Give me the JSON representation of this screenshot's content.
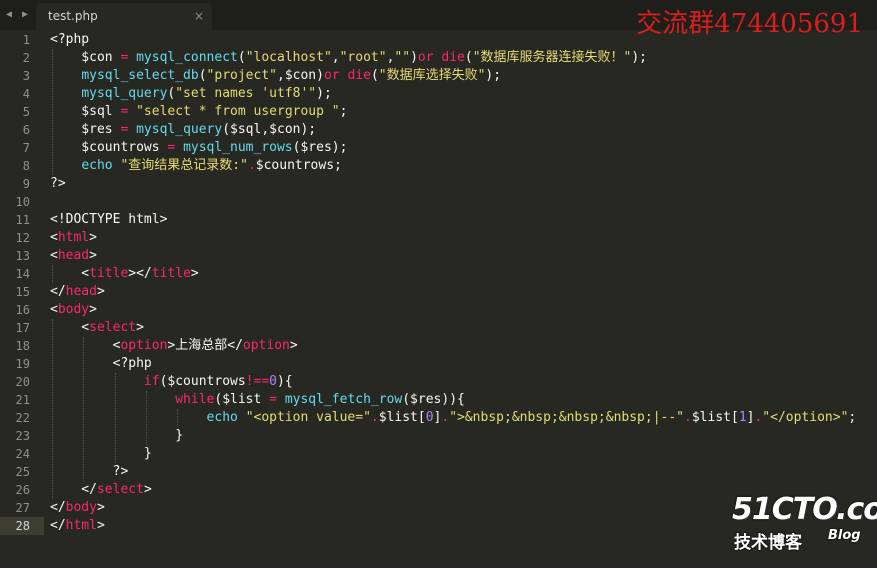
{
  "tabbar": {
    "nav_arrows": "◀ ▶",
    "tab_name": "test.php",
    "close_glyph": "×"
  },
  "watermark_text": "交流群474405691",
  "logo": {
    "main": "51CTO.com",
    "sub": "技术博客",
    "blog": "Blog"
  },
  "colors": {
    "background": "#272822",
    "keyword": "#f92672",
    "function": "#66d9ef",
    "string": "#e6db74",
    "number": "#ae81ff",
    "text": "#f8f8f2"
  },
  "active_line": 28,
  "line_numbers": [
    "1",
    "2",
    "3",
    "4",
    "5",
    "6",
    "7",
    "8",
    "9",
    "10",
    "11",
    "12",
    "13",
    "14",
    "15",
    "16",
    "17",
    "18",
    "19",
    "20",
    "21",
    "22",
    "23",
    "24",
    "25",
    "26",
    "27",
    "28"
  ],
  "code_lines": [
    [
      [
        "txt",
        "<?php"
      ]
    ],
    [
      [
        "txt",
        "    $con "
      ],
      [
        "kw",
        "="
      ],
      [
        "txt",
        " "
      ],
      [
        "fn",
        "mysql_connect"
      ],
      [
        "txt",
        "("
      ],
      [
        "str",
        "\"localhost\""
      ],
      [
        "txt",
        ","
      ],
      [
        "str",
        "\"root\""
      ],
      [
        "txt",
        ","
      ],
      [
        "str",
        "\"\""
      ],
      [
        "txt",
        ")"
      ],
      [
        "kw",
        "or"
      ],
      [
        "txt",
        " "
      ],
      [
        "kw",
        "die"
      ],
      [
        "txt",
        "("
      ],
      [
        "str",
        "\"数据库服务器连接失败！\""
      ],
      [
        "txt",
        ");"
      ]
    ],
    [
      [
        "txt",
        "    "
      ],
      [
        "fn",
        "mysql_select_db"
      ],
      [
        "txt",
        "("
      ],
      [
        "str",
        "\"project\""
      ],
      [
        "txt",
        ",$con)"
      ],
      [
        "kw",
        "or"
      ],
      [
        "txt",
        " "
      ],
      [
        "kw",
        "die"
      ],
      [
        "txt",
        "("
      ],
      [
        "str",
        "\"数据库选择失败\""
      ],
      [
        "txt",
        ");"
      ]
    ],
    [
      [
        "txt",
        "    "
      ],
      [
        "fn",
        "mysql_query"
      ],
      [
        "txt",
        "("
      ],
      [
        "str",
        "\"set names 'utf8'\""
      ],
      [
        "txt",
        ");"
      ]
    ],
    [
      [
        "txt",
        "    $sql "
      ],
      [
        "kw",
        "="
      ],
      [
        "txt",
        " "
      ],
      [
        "str",
        "\"select * from usergroup \""
      ],
      [
        "txt",
        ";"
      ]
    ],
    [
      [
        "txt",
        "    $res "
      ],
      [
        "kw",
        "="
      ],
      [
        "txt",
        " "
      ],
      [
        "fn",
        "mysql_query"
      ],
      [
        "txt",
        "($sql,$con);"
      ]
    ],
    [
      [
        "txt",
        "    $countrows "
      ],
      [
        "kw",
        "="
      ],
      [
        "txt",
        " "
      ],
      [
        "fn",
        "mysql_num_rows"
      ],
      [
        "txt",
        "($res);"
      ]
    ],
    [
      [
        "txt",
        "    "
      ],
      [
        "fn",
        "echo"
      ],
      [
        "txt",
        " "
      ],
      [
        "str",
        "\"查询结果总记录数:\""
      ],
      [
        "kw",
        "."
      ],
      [
        "txt",
        "$countrows;"
      ]
    ],
    [
      [
        "txt",
        "?>"
      ]
    ],
    [
      [
        "txt",
        ""
      ]
    ],
    [
      [
        "txt",
        "<!DOCTYPE html>"
      ]
    ],
    [
      [
        "txt",
        "<"
      ],
      [
        "tag",
        "html"
      ],
      [
        "txt",
        ">"
      ]
    ],
    [
      [
        "txt",
        "<"
      ],
      [
        "tag",
        "head"
      ],
      [
        "txt",
        ">"
      ]
    ],
    [
      [
        "txt",
        "    <"
      ],
      [
        "tag",
        "title"
      ],
      [
        "txt",
        "></"
      ],
      [
        "tag",
        "title"
      ],
      [
        "txt",
        ">"
      ]
    ],
    [
      [
        "txt",
        "</"
      ],
      [
        "tag",
        "head"
      ],
      [
        "txt",
        ">"
      ]
    ],
    [
      [
        "txt",
        "<"
      ],
      [
        "tag",
        "body"
      ],
      [
        "txt",
        ">"
      ]
    ],
    [
      [
        "txt",
        "    <"
      ],
      [
        "tag",
        "select"
      ],
      [
        "txt",
        ">"
      ]
    ],
    [
      [
        "txt",
        "        <"
      ],
      [
        "tag",
        "option"
      ],
      [
        "txt",
        ">上海总部</"
      ],
      [
        "tag",
        "option"
      ],
      [
        "txt",
        ">"
      ]
    ],
    [
      [
        "txt",
        "        <?php"
      ]
    ],
    [
      [
        "txt",
        "            "
      ],
      [
        "kw",
        "if"
      ],
      [
        "txt",
        "($countrows"
      ],
      [
        "kw",
        "!=="
      ],
      [
        "num",
        "0"
      ],
      [
        "txt",
        "){"
      ]
    ],
    [
      [
        "txt",
        "                "
      ],
      [
        "kw",
        "while"
      ],
      [
        "txt",
        "($list "
      ],
      [
        "kw",
        "="
      ],
      [
        "txt",
        " "
      ],
      [
        "fn",
        "mysql_fetch_row"
      ],
      [
        "txt",
        "($res)){"
      ]
    ],
    [
      [
        "txt",
        "                    "
      ],
      [
        "fn",
        "echo"
      ],
      [
        "txt",
        " "
      ],
      [
        "str",
        "\"<option value=\""
      ],
      [
        "kw",
        "."
      ],
      [
        "txt",
        "$list["
      ],
      [
        "num",
        "0"
      ],
      [
        "txt",
        "]"
      ],
      [
        "kw",
        "."
      ],
      [
        "str",
        "\">&nbsp;&nbsp;&nbsp;&nbsp;|--\""
      ],
      [
        "kw",
        "."
      ],
      [
        "txt",
        "$list["
      ],
      [
        "num",
        "1"
      ],
      [
        "txt",
        "]"
      ],
      [
        "kw",
        "."
      ],
      [
        "str",
        "\"</option>\""
      ],
      [
        "txt",
        ";"
      ]
    ],
    [
      [
        "txt",
        "                }"
      ]
    ],
    [
      [
        "txt",
        "            }"
      ]
    ],
    [
      [
        "txt",
        "        ?>"
      ]
    ],
    [
      [
        "txt",
        "    </"
      ],
      [
        "tag",
        "select"
      ],
      [
        "txt",
        ">"
      ]
    ],
    [
      [
        "txt",
        "</"
      ],
      [
        "tag",
        "body"
      ],
      [
        "txt",
        ">"
      ]
    ],
    [
      [
        "txt",
        "</"
      ],
      [
        "tag",
        "html"
      ],
      [
        "txt",
        ">"
      ]
    ]
  ]
}
